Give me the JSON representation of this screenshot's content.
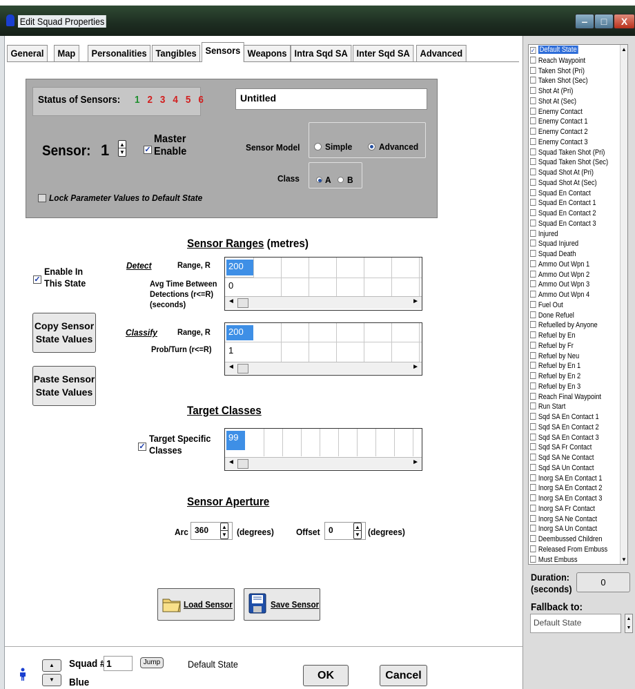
{
  "window": {
    "title": "Edit Squad Properties",
    "min_label": "‒",
    "max_label": "□",
    "close_label": "X"
  },
  "tabs": [
    {
      "label": "General"
    },
    {
      "label": "Map"
    },
    {
      "label": "Personalities"
    },
    {
      "label": "Tangibles"
    },
    {
      "label": "Sensors",
      "active": true
    },
    {
      "label": "Weapons"
    },
    {
      "label": "Intra Sqd SA"
    },
    {
      "label": "Inter Sqd SA"
    },
    {
      "label": "Advanced"
    }
  ],
  "status": {
    "label": "Status of Sensors:",
    "numbers": [
      "1",
      "2",
      "3",
      "4",
      "5",
      "6"
    ],
    "colors": {
      "active": "#1f8f2f",
      "inactive": "#d21f1f"
    },
    "name_value": "Untitled",
    "sensor_label": "Sensor:",
    "sensor_value": "1",
    "master_enable_line1": "Master",
    "master_enable_line2": "Enable",
    "master_enable_checked": true,
    "sensor_model_label": "Sensor Model",
    "model_options": [
      "Simple",
      "Advanced"
    ],
    "model_selected": "Advanced",
    "class_label": "Class",
    "class_options": [
      "A",
      "B"
    ],
    "class_selected": "A",
    "lock_label": "Lock Parameter Values to Default State"
  },
  "ranges": {
    "heading": "Sensor Ranges",
    "heading_unit": "(metres)",
    "enable_line1": "Enable In",
    "enable_line2": "This State",
    "detect_label": "Detect",
    "range_label": "Range, R",
    "avg_time_line1": "Avg Time Between",
    "avg_time_line2": "Detections (r<=R)",
    "avg_time_line3": "(seconds)",
    "detect_range_value": "200",
    "detect_time_value": "0",
    "classify_label": "Classify",
    "classify_range_label": "Range, R",
    "prob_label": "Prob/Turn (r<=R)",
    "classify_range_value": "200",
    "prob_value": "1"
  },
  "actions": {
    "copy_line1": "Copy Sensor",
    "copy_line2": "State Values",
    "paste_line1": "Paste Sensor",
    "paste_line2": "State Values",
    "load_label": "Load Sensor",
    "save_label": "Save Sensor"
  },
  "targets": {
    "heading": "Target Classes",
    "specific_line1": "Target Specific",
    "specific_line2": "Classes",
    "specific_checked": true,
    "value": "99"
  },
  "aperture": {
    "heading": "Sensor Aperture",
    "arc_label": "Arc",
    "arc_value": "360",
    "arc_unit": "(degrees)",
    "offset_label": "Offset",
    "offset_value": "0",
    "offset_unit": "(degrees)"
  },
  "footer": {
    "squad_label": "Squad #",
    "squad_value": "1",
    "jump_label": "Jump",
    "state_label": "Default State",
    "side_label": "Blue",
    "ok_label": "OK",
    "cancel_label": "Cancel"
  },
  "states": {
    "items": [
      {
        "label": "Default State",
        "checked": true,
        "selected": true
      },
      {
        "label": "Reach Waypoint"
      },
      {
        "label": "Taken Shot (Pri)"
      },
      {
        "label": "Taken Shot (Sec)"
      },
      {
        "label": "Shot At (Pri)"
      },
      {
        "label": "Shot At (Sec)"
      },
      {
        "label": "Enemy Contact"
      },
      {
        "label": "Enemy Contact 1"
      },
      {
        "label": "Enemy Contact 2"
      },
      {
        "label": "Enemy Contact 3"
      },
      {
        "label": "Squad Taken Shot (Pri)"
      },
      {
        "label": "Squad Taken Shot (Sec)"
      },
      {
        "label": "Squad Shot At (Pri)"
      },
      {
        "label": "Squad Shot At (Sec)"
      },
      {
        "label": "Squad En Contact"
      },
      {
        "label": "Squad En Contact 1"
      },
      {
        "label": "Squad En Contact 2"
      },
      {
        "label": "Squad En Contact 3"
      },
      {
        "label": "Injured"
      },
      {
        "label": "Squad Injured"
      },
      {
        "label": "Squad Death"
      },
      {
        "label": "Ammo Out Wpn 1"
      },
      {
        "label": "Ammo Out Wpn 2"
      },
      {
        "label": "Ammo Out Wpn 3"
      },
      {
        "label": "Ammo Out Wpn 4"
      },
      {
        "label": "Fuel Out"
      },
      {
        "label": "Done Refuel"
      },
      {
        "label": "Refuelled by Anyone"
      },
      {
        "label": "Refuel by En"
      },
      {
        "label": "Refuel by Fr"
      },
      {
        "label": "Refuel by Neu"
      },
      {
        "label": "Refuel by En 1"
      },
      {
        "label": "Refuel by En 2"
      },
      {
        "label": "Refuel by En 3"
      },
      {
        "label": "Reach Final Waypoint"
      },
      {
        "label": "Run Start"
      },
      {
        "label": "Sqd SA En Contact 1"
      },
      {
        "label": "Sqd SA En Contact 2"
      },
      {
        "label": "Sqd SA En Contact 3"
      },
      {
        "label": "Sqd SA Fr Contact"
      },
      {
        "label": "Sqd SA Ne Contact"
      },
      {
        "label": "Sqd SA Un Contact"
      },
      {
        "label": "Inorg SA En Contact 1"
      },
      {
        "label": "Inorg SA En Contact 2"
      },
      {
        "label": "Inorg SA En Contact 3"
      },
      {
        "label": "Inorg SA Fr Contact"
      },
      {
        "label": "Inorg SA Ne Contact"
      },
      {
        "label": "Inorg SA Un Contact"
      },
      {
        "label": "Deembussed Children"
      },
      {
        "label": "Released From Embuss"
      },
      {
        "label": "Must Embuss"
      }
    ],
    "duration_line1": "Duration:",
    "duration_line2": "(seconds)",
    "duration_value": "0",
    "fallback_label": "Fallback to:",
    "fallback_value": "Default State"
  }
}
